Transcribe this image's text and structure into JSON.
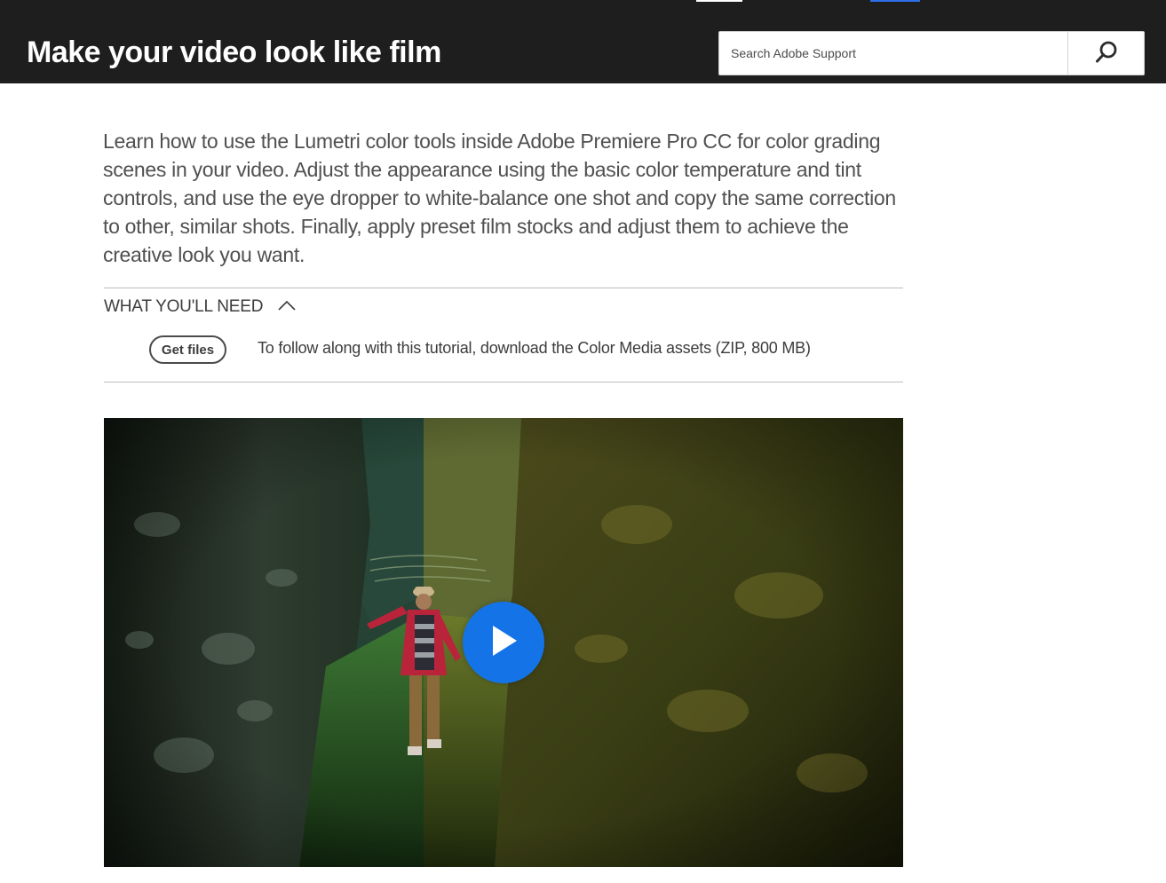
{
  "header": {
    "title": "Make your video look like film",
    "search": {
      "placeholder": "Search Adobe Support",
      "value": "",
      "icon": "search-icon"
    }
  },
  "intro": {
    "text": "Learn how to use the Lumetri color tools inside Adobe Premiere Pro CC for color grading scenes in your video. Adjust the appearance using the basic color temperature and tint controls, and use the eye dropper to white-balance one shot and copy the same correction to other, similar shots. Finally, apply preset film stocks and adjust them to achieve the creative look you want."
  },
  "what_you_need": {
    "title": "WHAT YOU'LL NEED",
    "toggle_icon": "chevron-up-icon",
    "button_label": "Get files",
    "description": "To follow along with this tutorial, download the Color Media assets (ZIP, 800 MB)"
  },
  "video": {
    "play_icon": "play-icon",
    "accent_color": "#1473e6"
  },
  "colors": {
    "header_bg": "#1e1e1e",
    "tab_indicator_blue": "#2d6ee8"
  }
}
